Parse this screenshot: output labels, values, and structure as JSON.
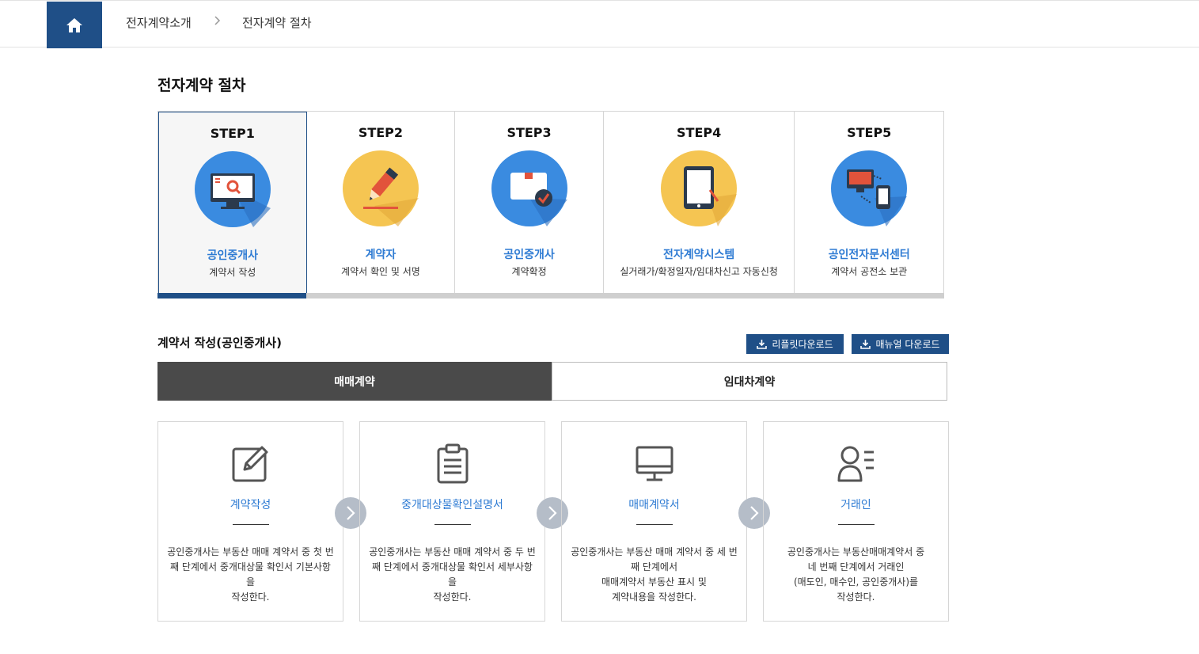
{
  "breadcrumb": {
    "home_icon": "home-icon",
    "items": [
      "전자계약소개",
      "전자계약 절차"
    ]
  },
  "page_title": "전자계약 절차",
  "steps": [
    {
      "num": "STEP1",
      "role": "공인중개사",
      "desc": "계약서 작성",
      "icon": "monitor-search-icon",
      "active": true
    },
    {
      "num": "STEP2",
      "role": "계약자",
      "desc": "계약서 확인 및 서명",
      "icon": "pencil-icon",
      "active": false
    },
    {
      "num": "STEP3",
      "role": "공인중개사",
      "desc": "계약확정",
      "icon": "document-check-icon",
      "active": false
    },
    {
      "num": "STEP4",
      "role": "전자계약시스템",
      "desc": "실거래가/확정일자/임대차신고 자동신청",
      "icon": "tablet-icon",
      "active": false
    },
    {
      "num": "STEP5",
      "role": "공인전자문서센터",
      "desc": "계약서 공전소 보관",
      "icon": "devices-sync-icon",
      "active": false
    }
  ],
  "section_title": "계약서 작성(공인중개사)",
  "buttons": {
    "leaflet": "리플릿다운로드",
    "manual": "매뉴얼 다운로드"
  },
  "tabs": [
    "매매계약",
    "임대차계약"
  ],
  "cards": [
    {
      "title": "계약작성",
      "icon": "edit-icon",
      "desc": "공인중개사는 부동산 매매 계약서 중 첫 번\n째 단계에서 중개대상물 확인서 기본사항을\n작성한다."
    },
    {
      "title": "중개대상물확인설명서",
      "icon": "clipboard-icon",
      "desc": "공인중개사는 부동산 매매 계약서 중 두 번\n째 단계에서 중개대상물 확인서 세부사항을\n작성한다."
    },
    {
      "title": "매매계약서",
      "icon": "monitor-icon",
      "desc": "공인중개사는 부동산 매매 계약서 중 세 번\n째 단계에서\n매매계약서 부동산 표시 및\n계약내용을 작성한다."
    },
    {
      "title": "거래인",
      "icon": "user-list-icon",
      "desc": "공인중개사는 부동산매매계약서 중\n네 번째 단계에서 거래인\n(매도인, 매수인, 공인중개사)를\n작성한다."
    }
  ],
  "colors": {
    "primary": "#1f4f87",
    "accent_blue": "#2e7bd3",
    "tab_active": "#4a4a4a",
    "circle_blue": "#3a8be0",
    "circle_yellow": "#f5c552"
  }
}
